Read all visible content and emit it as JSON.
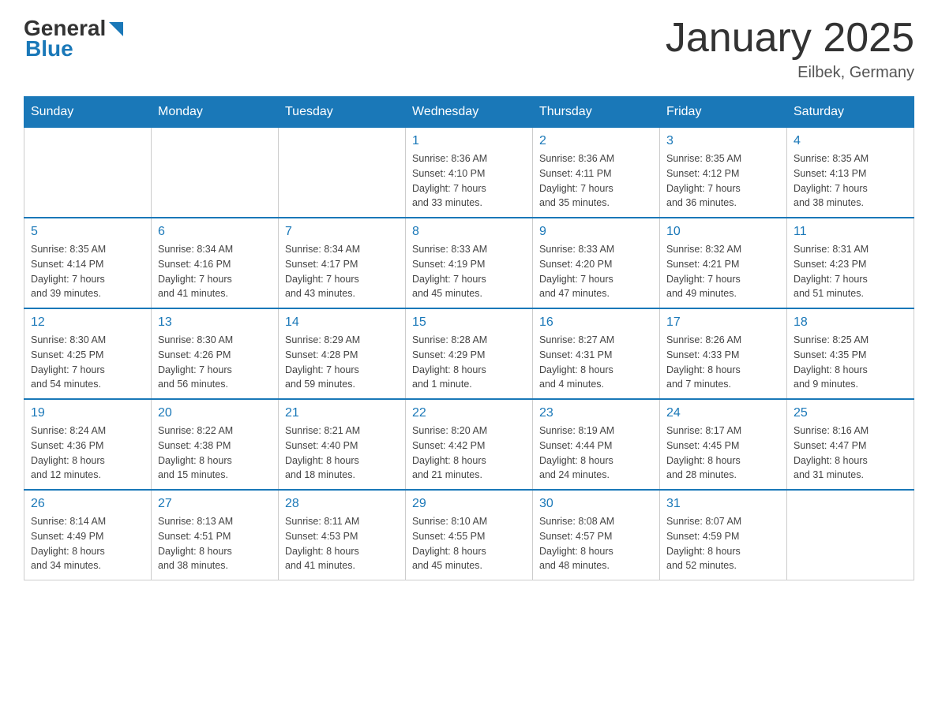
{
  "header": {
    "logo_general": "General",
    "logo_blue": "Blue",
    "title": "January 2025",
    "location": "Eilbek, Germany"
  },
  "weekdays": [
    "Sunday",
    "Monday",
    "Tuesday",
    "Wednesday",
    "Thursday",
    "Friday",
    "Saturday"
  ],
  "weeks": [
    [
      {
        "day": "",
        "info": ""
      },
      {
        "day": "",
        "info": ""
      },
      {
        "day": "",
        "info": ""
      },
      {
        "day": "1",
        "info": "Sunrise: 8:36 AM\nSunset: 4:10 PM\nDaylight: 7 hours\nand 33 minutes."
      },
      {
        "day": "2",
        "info": "Sunrise: 8:36 AM\nSunset: 4:11 PM\nDaylight: 7 hours\nand 35 minutes."
      },
      {
        "day": "3",
        "info": "Sunrise: 8:35 AM\nSunset: 4:12 PM\nDaylight: 7 hours\nand 36 minutes."
      },
      {
        "day": "4",
        "info": "Sunrise: 8:35 AM\nSunset: 4:13 PM\nDaylight: 7 hours\nand 38 minutes."
      }
    ],
    [
      {
        "day": "5",
        "info": "Sunrise: 8:35 AM\nSunset: 4:14 PM\nDaylight: 7 hours\nand 39 minutes."
      },
      {
        "day": "6",
        "info": "Sunrise: 8:34 AM\nSunset: 4:16 PM\nDaylight: 7 hours\nand 41 minutes."
      },
      {
        "day": "7",
        "info": "Sunrise: 8:34 AM\nSunset: 4:17 PM\nDaylight: 7 hours\nand 43 minutes."
      },
      {
        "day": "8",
        "info": "Sunrise: 8:33 AM\nSunset: 4:19 PM\nDaylight: 7 hours\nand 45 minutes."
      },
      {
        "day": "9",
        "info": "Sunrise: 8:33 AM\nSunset: 4:20 PM\nDaylight: 7 hours\nand 47 minutes."
      },
      {
        "day": "10",
        "info": "Sunrise: 8:32 AM\nSunset: 4:21 PM\nDaylight: 7 hours\nand 49 minutes."
      },
      {
        "day": "11",
        "info": "Sunrise: 8:31 AM\nSunset: 4:23 PM\nDaylight: 7 hours\nand 51 minutes."
      }
    ],
    [
      {
        "day": "12",
        "info": "Sunrise: 8:30 AM\nSunset: 4:25 PM\nDaylight: 7 hours\nand 54 minutes."
      },
      {
        "day": "13",
        "info": "Sunrise: 8:30 AM\nSunset: 4:26 PM\nDaylight: 7 hours\nand 56 minutes."
      },
      {
        "day": "14",
        "info": "Sunrise: 8:29 AM\nSunset: 4:28 PM\nDaylight: 7 hours\nand 59 minutes."
      },
      {
        "day": "15",
        "info": "Sunrise: 8:28 AM\nSunset: 4:29 PM\nDaylight: 8 hours\nand 1 minute."
      },
      {
        "day": "16",
        "info": "Sunrise: 8:27 AM\nSunset: 4:31 PM\nDaylight: 8 hours\nand 4 minutes."
      },
      {
        "day": "17",
        "info": "Sunrise: 8:26 AM\nSunset: 4:33 PM\nDaylight: 8 hours\nand 7 minutes."
      },
      {
        "day": "18",
        "info": "Sunrise: 8:25 AM\nSunset: 4:35 PM\nDaylight: 8 hours\nand 9 minutes."
      }
    ],
    [
      {
        "day": "19",
        "info": "Sunrise: 8:24 AM\nSunset: 4:36 PM\nDaylight: 8 hours\nand 12 minutes."
      },
      {
        "day": "20",
        "info": "Sunrise: 8:22 AM\nSunset: 4:38 PM\nDaylight: 8 hours\nand 15 minutes."
      },
      {
        "day": "21",
        "info": "Sunrise: 8:21 AM\nSunset: 4:40 PM\nDaylight: 8 hours\nand 18 minutes."
      },
      {
        "day": "22",
        "info": "Sunrise: 8:20 AM\nSunset: 4:42 PM\nDaylight: 8 hours\nand 21 minutes."
      },
      {
        "day": "23",
        "info": "Sunrise: 8:19 AM\nSunset: 4:44 PM\nDaylight: 8 hours\nand 24 minutes."
      },
      {
        "day": "24",
        "info": "Sunrise: 8:17 AM\nSunset: 4:45 PM\nDaylight: 8 hours\nand 28 minutes."
      },
      {
        "day": "25",
        "info": "Sunrise: 8:16 AM\nSunset: 4:47 PM\nDaylight: 8 hours\nand 31 minutes."
      }
    ],
    [
      {
        "day": "26",
        "info": "Sunrise: 8:14 AM\nSunset: 4:49 PM\nDaylight: 8 hours\nand 34 minutes."
      },
      {
        "day": "27",
        "info": "Sunrise: 8:13 AM\nSunset: 4:51 PM\nDaylight: 8 hours\nand 38 minutes."
      },
      {
        "day": "28",
        "info": "Sunrise: 8:11 AM\nSunset: 4:53 PM\nDaylight: 8 hours\nand 41 minutes."
      },
      {
        "day": "29",
        "info": "Sunrise: 8:10 AM\nSunset: 4:55 PM\nDaylight: 8 hours\nand 45 minutes."
      },
      {
        "day": "30",
        "info": "Sunrise: 8:08 AM\nSunset: 4:57 PM\nDaylight: 8 hours\nand 48 minutes."
      },
      {
        "day": "31",
        "info": "Sunrise: 8:07 AM\nSunset: 4:59 PM\nDaylight: 8 hours\nand 52 minutes."
      },
      {
        "day": "",
        "info": ""
      }
    ]
  ]
}
